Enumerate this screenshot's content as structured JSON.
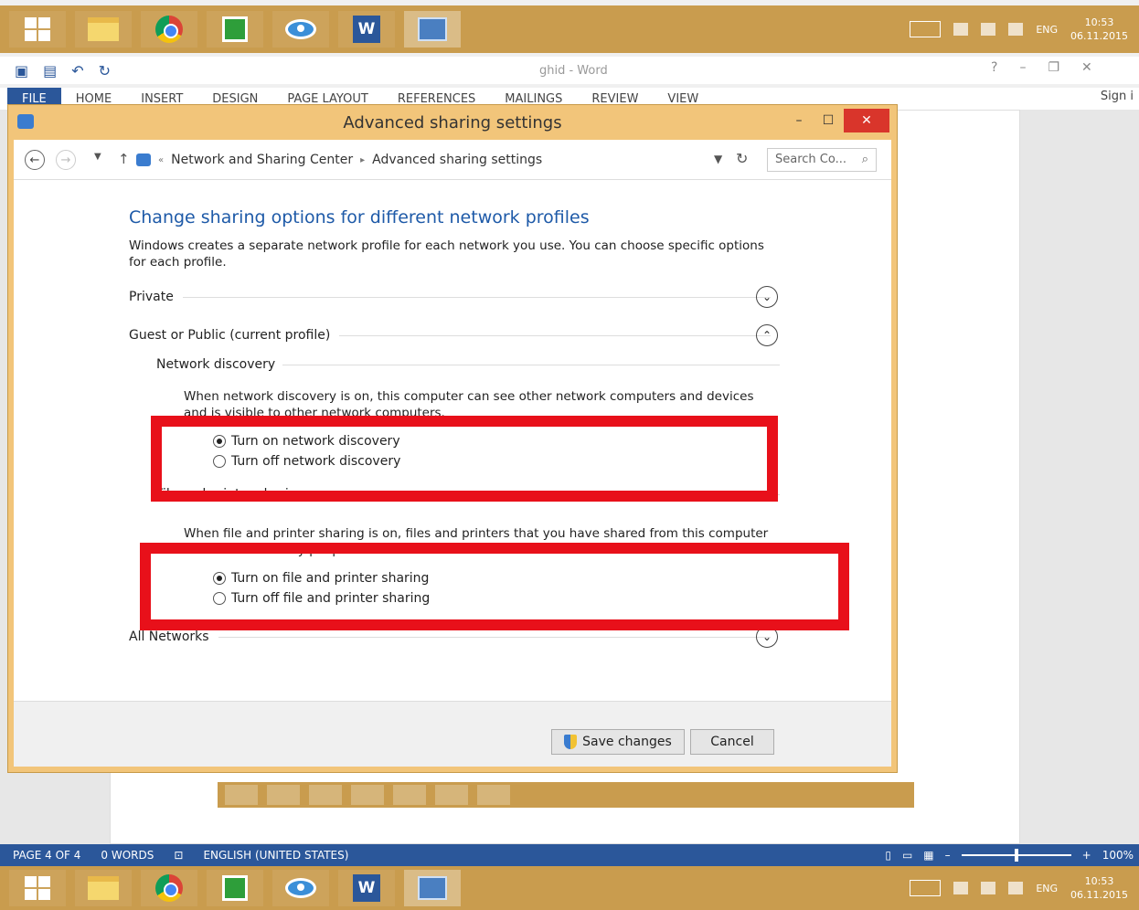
{
  "taskbar": {
    "tray_lang": "ENG",
    "time": "10:53",
    "date": "06.11.2015"
  },
  "word": {
    "title": "ghid - Word",
    "ribbon_tabs": [
      "FILE",
      "HOME",
      "INSERT",
      "DESIGN",
      "PAGE LAYOUT",
      "REFERENCES",
      "MAILINGS",
      "REVIEW",
      "VIEW"
    ],
    "sign_in": "Sign i",
    "status": {
      "page": "PAGE 4 OF 4",
      "words": "0 WORDS",
      "language": "ENGLISH (UNITED STATES)",
      "zoom": "100%"
    }
  },
  "dialog": {
    "title": "Advanced sharing settings",
    "breadcrumb": [
      "Network and Sharing Center",
      "Advanced sharing settings"
    ],
    "search_placeholder": "Search Co...",
    "heading": "Change sharing options for different network profiles",
    "description": "Windows creates a separate network profile for each network you use. You can choose specific options for each profile.",
    "profiles": {
      "private": "Private",
      "guest_public": "Guest or Public (current profile)",
      "all_networks": "All Networks"
    },
    "network_discovery": {
      "title": "Network discovery",
      "text": "When network discovery is on, this computer can see other network computers and devices and is visible to other network computers.",
      "on_label": "Turn on network discovery",
      "off_label": "Turn off network discovery"
    },
    "file_sharing": {
      "title": "File and printer sharing",
      "text": "When file and printer sharing is on, files and printers that you have shared from this computer can be accessed by people on the network.",
      "on_label": "Turn on file and printer sharing",
      "off_label": "Turn off file and printer sharing"
    },
    "buttons": {
      "save": "Save changes",
      "cancel": "Cancel"
    }
  },
  "colors": {
    "taskbar": "#c99c4e",
    "dialog_frame": "#f2c57a",
    "heading": "#1e5aa8",
    "highlight": "#e8101a",
    "word_blue": "#2b579a"
  }
}
